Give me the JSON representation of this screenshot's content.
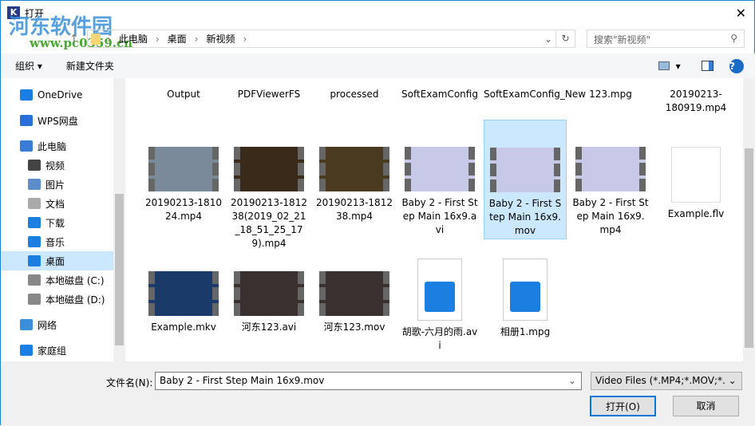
{
  "title": "打开",
  "watermark": {
    "name": "河东软件园",
    "url": "www.pc0359.cn"
  },
  "address": {
    "crumbs": [
      "此电脑",
      "桌面",
      "新视频"
    ]
  },
  "search": {
    "placeholder": "搜索\"新视频\""
  },
  "toolbar": {
    "organize": "组织 ▾",
    "new_folder": "新建文件夹"
  },
  "sidebar": [
    {
      "label": "OneDrive",
      "color": "#1a7fe0",
      "sub": false
    },
    {
      "label": "WPS网盘",
      "color": "#2a6fd8",
      "sub": false
    },
    {
      "label": "此电脑",
      "color": "#3a7bd5",
      "sub": false
    },
    {
      "label": "视频",
      "color": "#444",
      "sub": true
    },
    {
      "label": "图片",
      "color": "#5b8ec9",
      "sub": true
    },
    {
      "label": "文档",
      "color": "#aaa",
      "sub": true
    },
    {
      "label": "下载",
      "color": "#1a7fe0",
      "sub": true
    },
    {
      "label": "音乐",
      "color": "#1a7fe0",
      "sub": true
    },
    {
      "label": "桌面",
      "color": "#1a7fe0",
      "sub": true,
      "selected": true
    },
    {
      "label": "本地磁盘 (C:)",
      "color": "#888",
      "sub": true
    },
    {
      "label": "本地磁盘 (D:)",
      "color": "#888",
      "sub": true
    },
    {
      "label": "网络",
      "color": "#3a8fd8",
      "sub": false
    },
    {
      "label": "家庭组",
      "color": "#1a7fe0",
      "sub": false
    }
  ],
  "files_row1": [
    "Output",
    "PDFViewerFS",
    "processed",
    "SoftExamConfig",
    "SoftExamConfig_New",
    "123.mpg",
    "20190213-180919.mp4"
  ],
  "files_row2": [
    {
      "name": "20190213-181024.mp4",
      "kind": "video",
      "tint": "#7a8a9a"
    },
    {
      "name": "20190213-181238(2019_02_21_18_51_25_179).mp4",
      "kind": "video",
      "tint": "#3a2a1a"
    },
    {
      "name": "20190213-181238.mp4",
      "kind": "video",
      "tint": "#4a3a20"
    },
    {
      "name": "Baby 2 - First Step Main 16x9.avi",
      "kind": "video",
      "tint": "#c8c8e8"
    },
    {
      "name": "Baby 2 - First Step Main 16x9.mov",
      "kind": "video",
      "tint": "#c8c8e8",
      "selected": true
    },
    {
      "name": "Baby 2 - First Step Main 16x9.mp4",
      "kind": "video",
      "tint": "#c8c8e8"
    },
    {
      "name": "Example.flv",
      "kind": "doc"
    }
  ],
  "files_row3": [
    {
      "name": "Example.mkv",
      "kind": "video",
      "tint": "#1a3a6a"
    },
    {
      "name": "河东123.avi",
      "kind": "video",
      "tint": "#3a3030"
    },
    {
      "name": "河东123.mov",
      "kind": "video",
      "tint": "#3a3030"
    },
    {
      "name": "胡歌-六月的雨.avi",
      "kind": "clap"
    },
    {
      "name": "相册1.mpg",
      "kind": "clap"
    }
  ],
  "bottom": {
    "filename_label": "文件名(N):",
    "filename": "Baby 2 - First Step Main 16x9.mov",
    "filetype": "Video Files  (*.MP4;*.MOV;*.",
    "open": "打开(O)",
    "cancel": "取消"
  }
}
